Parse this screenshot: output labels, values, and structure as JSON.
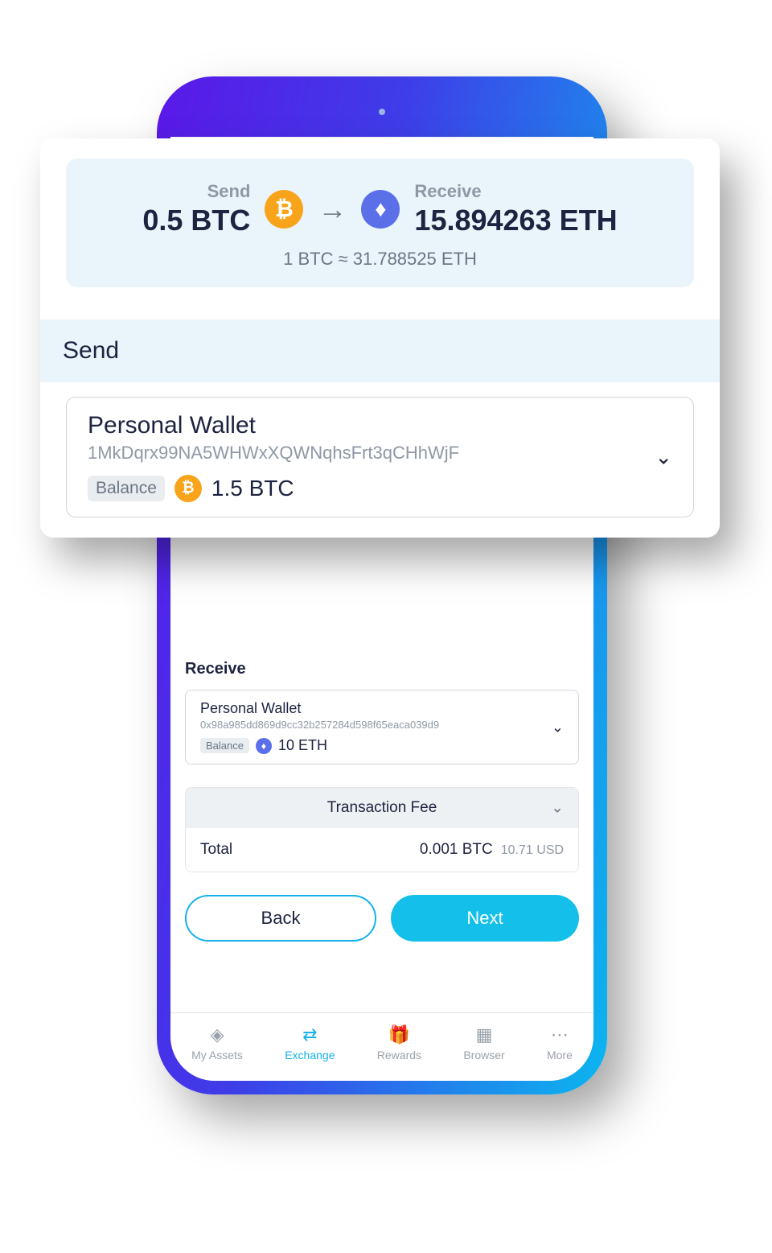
{
  "summary": {
    "send_label": "Send",
    "send_value": "0.5 BTC",
    "receive_label": "Receive",
    "receive_value": "15.894263 ETH",
    "rate": "1 BTC ≈ 31.788525 ETH"
  },
  "send_section": {
    "heading": "Send",
    "wallet_name": "Personal Wallet",
    "wallet_address": "1MkDqrx99NA5WHWxXQWNqhsFrt3qCHhWjF",
    "balance_label": "Balance",
    "balance_value": "1.5 BTC"
  },
  "receive_section": {
    "heading": "Receive",
    "wallet_name": "Personal Wallet",
    "wallet_address": "0x98a985dd869d9cc32b257284d598f65eaca039d9",
    "balance_label": "Balance",
    "balance_value": "10 ETH"
  },
  "fee": {
    "header": "Transaction Fee",
    "total_label": "Total",
    "btc_amount": "0.001 BTC",
    "usd_amount": "10.71 USD"
  },
  "buttons": {
    "back": "Back",
    "next": "Next"
  },
  "tabs": {
    "assets": "My Assets",
    "exchange": "Exchange",
    "rewards": "Rewards",
    "browser": "Browser",
    "more": "More"
  }
}
